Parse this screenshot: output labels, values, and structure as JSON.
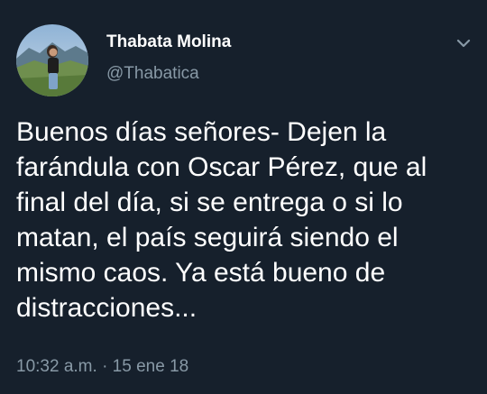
{
  "tweet": {
    "display_name": "Thabata Molina",
    "handle": "@Thabatica",
    "text_lines": [
      "Buenos días señores- Dejen la",
      "farándula con Oscar Pérez, que al",
      "final del día, si se entrega o si lo",
      "matan, el país seguirá siendo el",
      "mismo caos. Ya está bueno de",
      "distracciones..."
    ],
    "time": "10:32 a.m.",
    "separator": "·",
    "date": "15 ene 18"
  },
  "icons": {
    "menu": "chevron-down-icon",
    "avatar": "profile-photo"
  },
  "colors": {
    "background": "#16202c",
    "primary_text": "#ffffff",
    "secondary_text": "#8899a6"
  }
}
